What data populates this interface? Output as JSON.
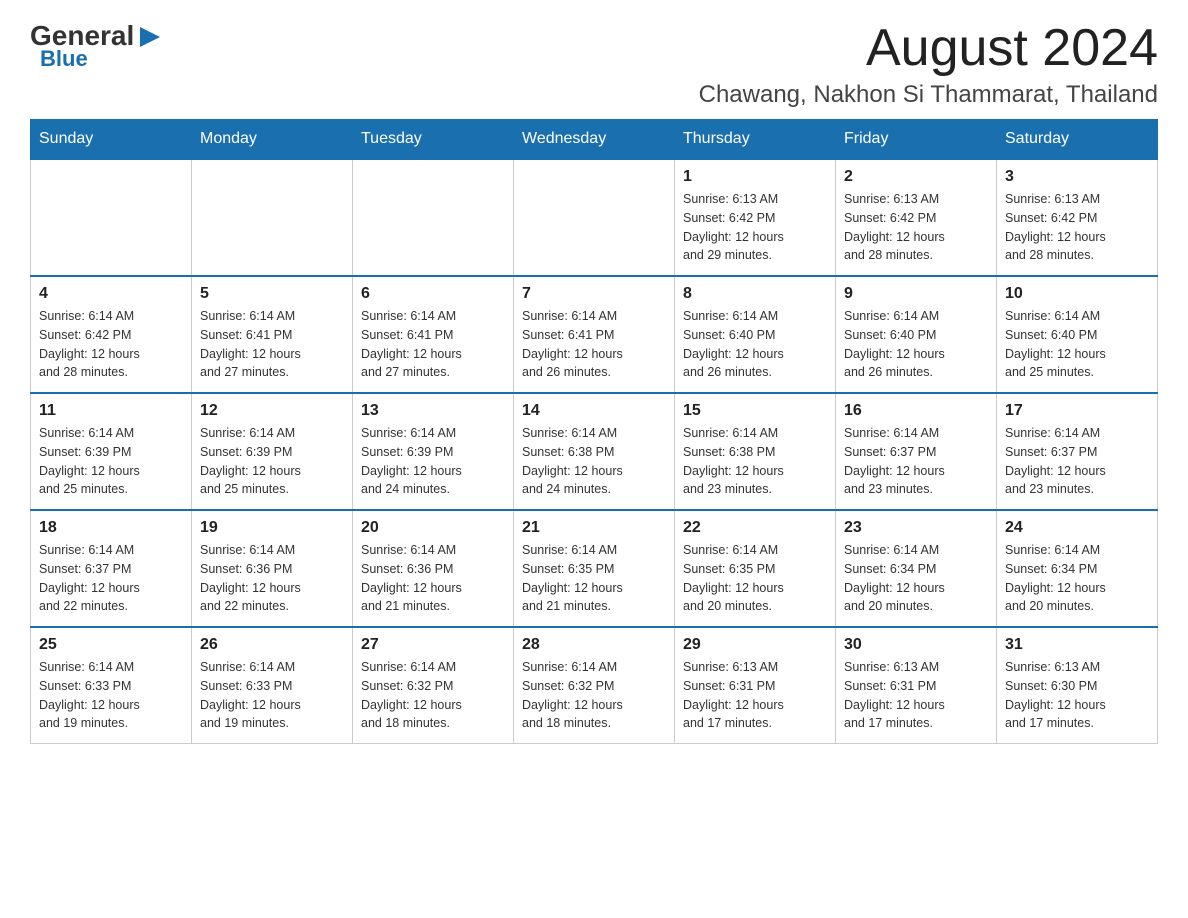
{
  "header": {
    "logo_text_general": "General",
    "logo_text_blue": "Blue",
    "month_title": "August 2024",
    "location": "Chawang, Nakhon Si Thammarat, Thailand"
  },
  "days_of_week": [
    "Sunday",
    "Monday",
    "Tuesday",
    "Wednesday",
    "Thursday",
    "Friday",
    "Saturday"
  ],
  "weeks": [
    [
      {
        "day": "",
        "info": ""
      },
      {
        "day": "",
        "info": ""
      },
      {
        "day": "",
        "info": ""
      },
      {
        "day": "",
        "info": ""
      },
      {
        "day": "1",
        "info": "Sunrise: 6:13 AM\nSunset: 6:42 PM\nDaylight: 12 hours\nand 29 minutes."
      },
      {
        "day": "2",
        "info": "Sunrise: 6:13 AM\nSunset: 6:42 PM\nDaylight: 12 hours\nand 28 minutes."
      },
      {
        "day": "3",
        "info": "Sunrise: 6:13 AM\nSunset: 6:42 PM\nDaylight: 12 hours\nand 28 minutes."
      }
    ],
    [
      {
        "day": "4",
        "info": "Sunrise: 6:14 AM\nSunset: 6:42 PM\nDaylight: 12 hours\nand 28 minutes."
      },
      {
        "day": "5",
        "info": "Sunrise: 6:14 AM\nSunset: 6:41 PM\nDaylight: 12 hours\nand 27 minutes."
      },
      {
        "day": "6",
        "info": "Sunrise: 6:14 AM\nSunset: 6:41 PM\nDaylight: 12 hours\nand 27 minutes."
      },
      {
        "day": "7",
        "info": "Sunrise: 6:14 AM\nSunset: 6:41 PM\nDaylight: 12 hours\nand 26 minutes."
      },
      {
        "day": "8",
        "info": "Sunrise: 6:14 AM\nSunset: 6:40 PM\nDaylight: 12 hours\nand 26 minutes."
      },
      {
        "day": "9",
        "info": "Sunrise: 6:14 AM\nSunset: 6:40 PM\nDaylight: 12 hours\nand 26 minutes."
      },
      {
        "day": "10",
        "info": "Sunrise: 6:14 AM\nSunset: 6:40 PM\nDaylight: 12 hours\nand 25 minutes."
      }
    ],
    [
      {
        "day": "11",
        "info": "Sunrise: 6:14 AM\nSunset: 6:39 PM\nDaylight: 12 hours\nand 25 minutes."
      },
      {
        "day": "12",
        "info": "Sunrise: 6:14 AM\nSunset: 6:39 PM\nDaylight: 12 hours\nand 25 minutes."
      },
      {
        "day": "13",
        "info": "Sunrise: 6:14 AM\nSunset: 6:39 PM\nDaylight: 12 hours\nand 24 minutes."
      },
      {
        "day": "14",
        "info": "Sunrise: 6:14 AM\nSunset: 6:38 PM\nDaylight: 12 hours\nand 24 minutes."
      },
      {
        "day": "15",
        "info": "Sunrise: 6:14 AM\nSunset: 6:38 PM\nDaylight: 12 hours\nand 23 minutes."
      },
      {
        "day": "16",
        "info": "Sunrise: 6:14 AM\nSunset: 6:37 PM\nDaylight: 12 hours\nand 23 minutes."
      },
      {
        "day": "17",
        "info": "Sunrise: 6:14 AM\nSunset: 6:37 PM\nDaylight: 12 hours\nand 23 minutes."
      }
    ],
    [
      {
        "day": "18",
        "info": "Sunrise: 6:14 AM\nSunset: 6:37 PM\nDaylight: 12 hours\nand 22 minutes."
      },
      {
        "day": "19",
        "info": "Sunrise: 6:14 AM\nSunset: 6:36 PM\nDaylight: 12 hours\nand 22 minutes."
      },
      {
        "day": "20",
        "info": "Sunrise: 6:14 AM\nSunset: 6:36 PM\nDaylight: 12 hours\nand 21 minutes."
      },
      {
        "day": "21",
        "info": "Sunrise: 6:14 AM\nSunset: 6:35 PM\nDaylight: 12 hours\nand 21 minutes."
      },
      {
        "day": "22",
        "info": "Sunrise: 6:14 AM\nSunset: 6:35 PM\nDaylight: 12 hours\nand 20 minutes."
      },
      {
        "day": "23",
        "info": "Sunrise: 6:14 AM\nSunset: 6:34 PM\nDaylight: 12 hours\nand 20 minutes."
      },
      {
        "day": "24",
        "info": "Sunrise: 6:14 AM\nSunset: 6:34 PM\nDaylight: 12 hours\nand 20 minutes."
      }
    ],
    [
      {
        "day": "25",
        "info": "Sunrise: 6:14 AM\nSunset: 6:33 PM\nDaylight: 12 hours\nand 19 minutes."
      },
      {
        "day": "26",
        "info": "Sunrise: 6:14 AM\nSunset: 6:33 PM\nDaylight: 12 hours\nand 19 minutes."
      },
      {
        "day": "27",
        "info": "Sunrise: 6:14 AM\nSunset: 6:32 PM\nDaylight: 12 hours\nand 18 minutes."
      },
      {
        "day": "28",
        "info": "Sunrise: 6:14 AM\nSunset: 6:32 PM\nDaylight: 12 hours\nand 18 minutes."
      },
      {
        "day": "29",
        "info": "Sunrise: 6:13 AM\nSunset: 6:31 PM\nDaylight: 12 hours\nand 17 minutes."
      },
      {
        "day": "30",
        "info": "Sunrise: 6:13 AM\nSunset: 6:31 PM\nDaylight: 12 hours\nand 17 minutes."
      },
      {
        "day": "31",
        "info": "Sunrise: 6:13 AM\nSunset: 6:30 PM\nDaylight: 12 hours\nand 17 minutes."
      }
    ]
  ]
}
